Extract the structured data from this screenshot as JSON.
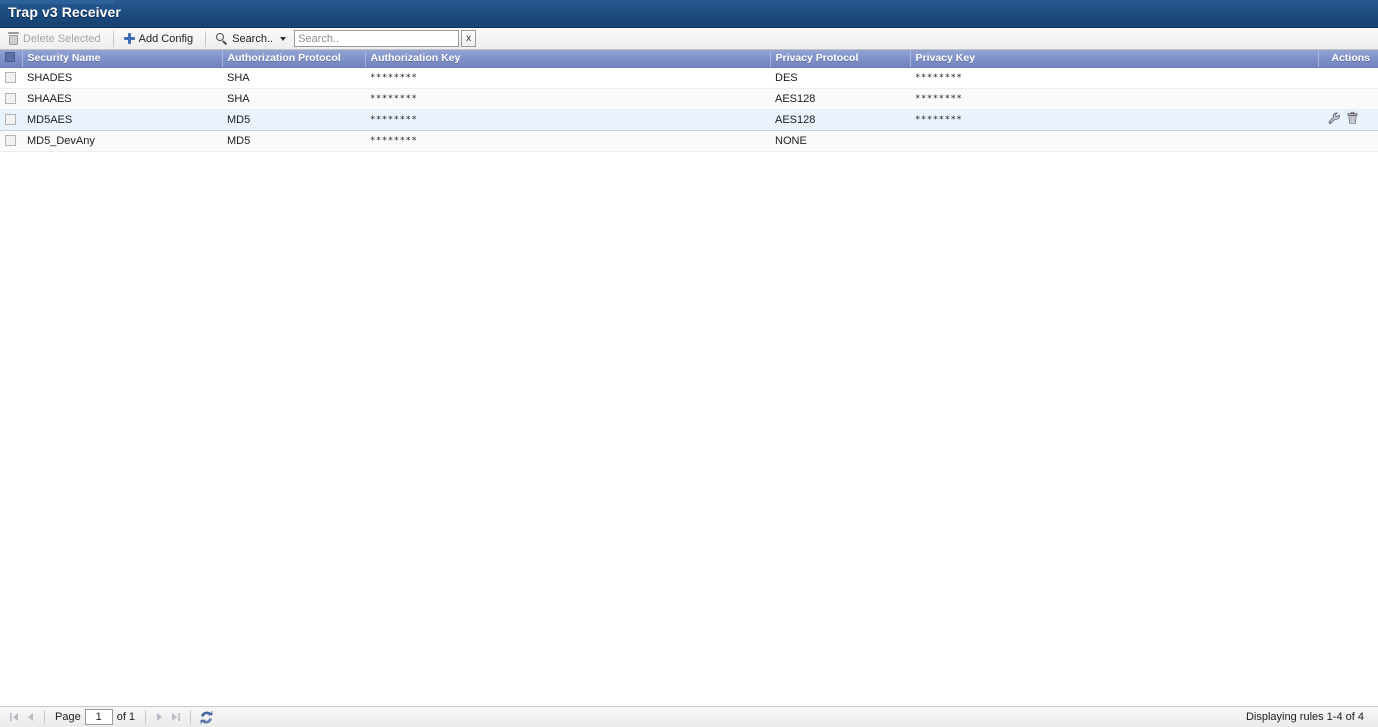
{
  "window": {
    "title": "Trap v3 Receiver"
  },
  "toolbar": {
    "delete_selected_label": "Delete Selected",
    "delete_selected_icon": "trash-icon",
    "delete_selected_disabled": true,
    "add_config_label": "Add Config",
    "add_config_icon": "plus-icon",
    "search_menu_label": "Search..",
    "search_menu_icon": "search-icon",
    "search_input_value": "",
    "search_input_placeholder": "Search..",
    "search_clear_label": "x"
  },
  "grid": {
    "columns": [
      {
        "key": "check",
        "label": ""
      },
      {
        "key": "security_name",
        "label": "Security Name"
      },
      {
        "key": "auth_protocol",
        "label": "Authorization Protocol"
      },
      {
        "key": "auth_key",
        "label": "Authorization Key"
      },
      {
        "key": "priv_protocol",
        "label": "Privacy Protocol"
      },
      {
        "key": "priv_key",
        "label": "Privacy Key"
      },
      {
        "key": "actions",
        "label": "Actions"
      }
    ],
    "rows": [
      {
        "security_name": "SHADES",
        "auth_protocol": "SHA",
        "auth_key": "********",
        "priv_protocol": "DES",
        "priv_key": "********",
        "selected": false,
        "hovered": false,
        "actions_visible": false
      },
      {
        "security_name": "SHAAES",
        "auth_protocol": "SHA",
        "auth_key": "********",
        "priv_protocol": "AES128",
        "priv_key": "********",
        "selected": false,
        "hovered": false,
        "actions_visible": false
      },
      {
        "security_name": "MD5AES",
        "auth_protocol": "MD5",
        "auth_key": "********",
        "priv_protocol": "AES128",
        "priv_key": "********",
        "selected": false,
        "hovered": true,
        "actions_visible": true,
        "actions": [
          {
            "name": "edit-icon",
            "title": "Edit"
          },
          {
            "name": "delete-icon",
            "title": "Delete"
          }
        ]
      },
      {
        "security_name": "MD5_DevAny",
        "auth_protocol": "MD5",
        "auth_key": "********",
        "priv_protocol": "NONE",
        "priv_key": "",
        "selected": false,
        "hovered": false,
        "actions_visible": false
      }
    ]
  },
  "pager": {
    "first_icon": "first-page-icon",
    "prev_icon": "previous-page-icon",
    "page_label": "Page",
    "page_value": "1",
    "of_label": "of 1",
    "next_icon": "next-page-icon",
    "last_icon": "last-page-icon",
    "refresh_icon": "refresh-icon",
    "status": "Displaying rules 1-4 of 4"
  },
  "colors": {
    "title_bar": "#1b4a7e",
    "header_row": "#7a8dc4",
    "row_hover": "#eaf3fb",
    "row_alt": "#fafafa",
    "accent_blue": "#3e6db5"
  }
}
